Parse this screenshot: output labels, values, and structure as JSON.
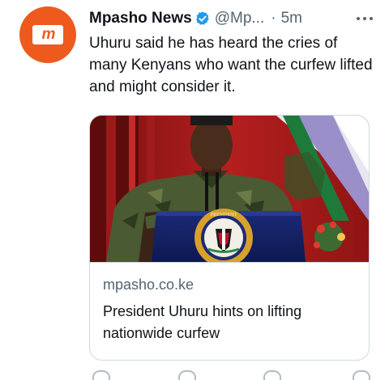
{
  "account": {
    "logo_text": "m",
    "name": "Mpasho News",
    "handle": "@Mp...",
    "separator": "·",
    "time": "5m",
    "more_icon": "more-horizontal-icon"
  },
  "tweet": {
    "text": "Uhuru said he has heard the cries of many Kenyans who want the curfew lifted and might consider it."
  },
  "card": {
    "domain": "mpasho.co.ke",
    "title": "President Uhuru hints on lifting nationwide curfew",
    "seal_text": "PRESIDENT"
  },
  "colors": {
    "brand": "#ee5a1e",
    "verified": "#1d9bf0",
    "secondary_text": "#536471"
  }
}
